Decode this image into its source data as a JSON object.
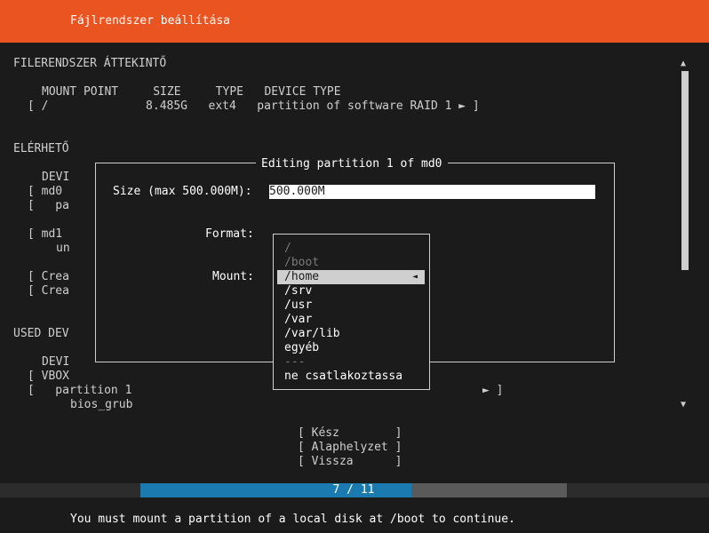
{
  "header": {
    "title": "Fájlrendszer beállítása"
  },
  "overview": {
    "heading": "FILERENDSZER ÁTTEKINTŐ",
    "columns": "MOUNT POINT     SIZE     TYPE   DEVICE TYPE",
    "row": "[ /              8.485G   ext4   partition of software RAID 1 ► ]"
  },
  "available": {
    "heading": "ELÉRHETŐ",
    "lines": [
      "DEVI",
      "[ md0",
      "[   pa",
      "[ md1",
      "un",
      "[ Crea",
      "[ Crea"
    ]
  },
  "used": {
    "heading": "USED DEV",
    "lines": [
      "DEVI",
      "[ VBOX",
      "[   partition 1",
      "bios_grub"
    ],
    "row_end": "► ]"
  },
  "dialog": {
    "title": "Editing partition 1 of md0",
    "size_label": "Size (max 500.000M):",
    "size_value": "500.000M",
    "format_label": "Format:",
    "mount_label": "Mount:"
  },
  "mount_menu": {
    "options": [
      "/",
      "/boot",
      "/home",
      "/srv",
      "/usr",
      "/var",
      "/var/lib",
      "egyéb",
      "---",
      "ne csatlakoztassa"
    ],
    "selected_index": 2,
    "selected_marker": "◄"
  },
  "buttons": {
    "done": "[ Kész        ]",
    "reset": "[ Alaphelyzet ]",
    "back": "[ Vissza      ]"
  },
  "scroll": {
    "up": "▲",
    "down": "▼"
  },
  "progress": {
    "text": "7 / 11",
    "current": 7,
    "total": 11
  },
  "footer": {
    "message": "You must mount a partition of a local disk at /boot to continue."
  },
  "colors": {
    "header": "#e95420",
    "progress_fill": "#1b7ab0",
    "background": "#1b1b1b"
  }
}
